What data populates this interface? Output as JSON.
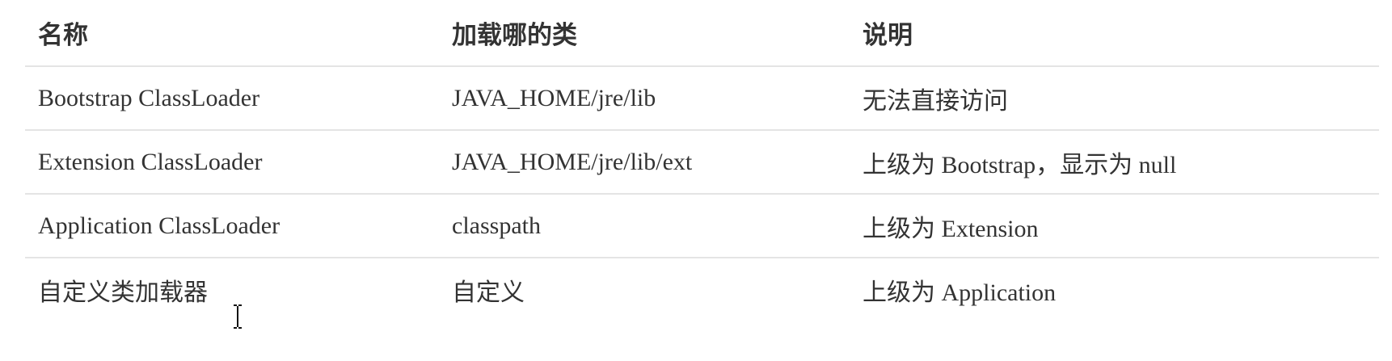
{
  "table": {
    "headers": [
      "名称",
      "加载哪的类",
      "说明"
    ],
    "rows": [
      [
        "Bootstrap ClassLoader",
        "JAVA_HOME/jre/lib",
        "无法直接访问"
      ],
      [
        "Extension ClassLoader",
        "JAVA_HOME/jre/lib/ext",
        "上级为 Bootstrap，显示为 null"
      ],
      [
        "Application ClassLoader",
        "classpath",
        "上级为 Extension"
      ],
      [
        "自定义类加载器",
        "自定义",
        "上级为 Application"
      ]
    ]
  },
  "cursor": {
    "icon": "text-cursor-icon"
  }
}
